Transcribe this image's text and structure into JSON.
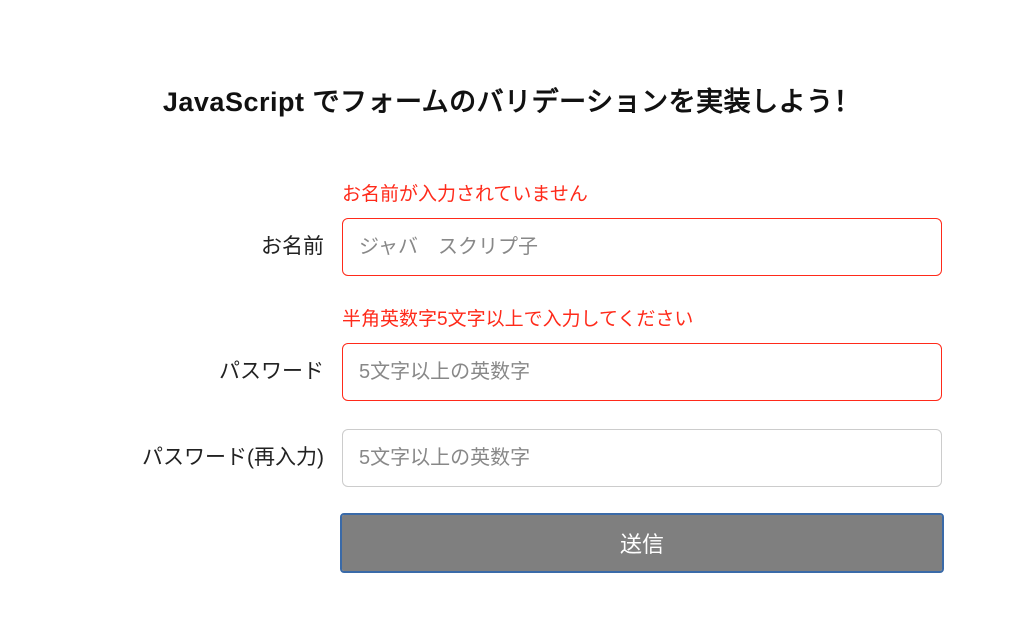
{
  "title": "JavaScript でフォームのバリデーションを実装しよう！",
  "fields": {
    "name": {
      "label": "お名前",
      "placeholder": "ジャバ　スクリプ子",
      "value": "",
      "error": "お名前が入力されていません",
      "hasError": true
    },
    "password": {
      "label": "パスワード",
      "placeholder": "5文字以上の英数字",
      "value": "",
      "error": "半角英数字5文字以上で入力してください",
      "hasError": true
    },
    "passwordConfirm": {
      "label": "パスワード(再入力)",
      "placeholder": "5文字以上の英数字",
      "value": "",
      "error": "",
      "hasError": false
    }
  },
  "submit": {
    "label": "送信"
  },
  "colors": {
    "error": "#ff2a1a",
    "buttonBg": "#7f7f7f",
    "focusOutline": "#3a6aa8"
  }
}
